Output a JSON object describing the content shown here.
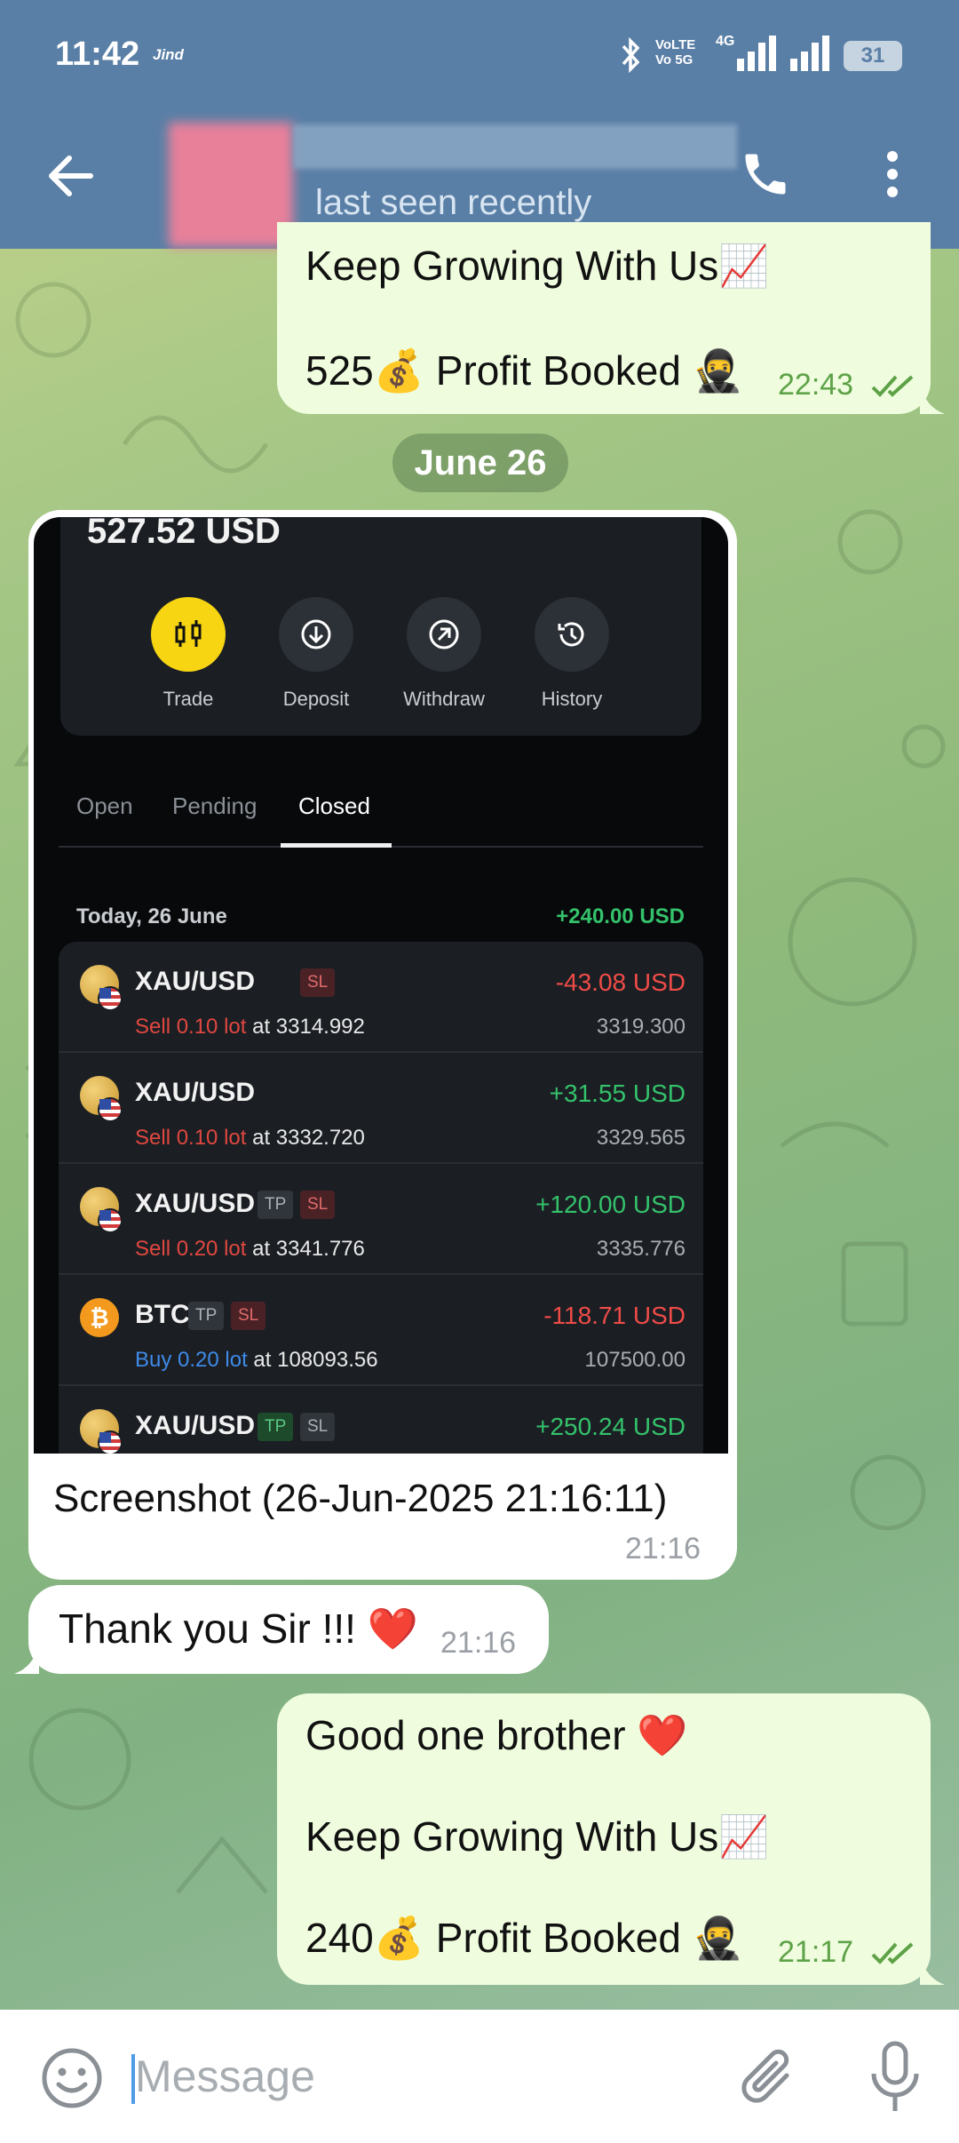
{
  "status_bar": {
    "time": "11:42",
    "carrier": "Jind",
    "volte_line1": "VoLTE",
    "volte_line2": "Vo 5G",
    "network": "4G",
    "battery": "31"
  },
  "header": {
    "subtitle": "last seen recently"
  },
  "messages": {
    "m1": {
      "line1": "Keep Growing With Us📈",
      "line2": "525💰 Profit Booked 🥷",
      "time": "22:43"
    },
    "date_divider": "June 26",
    "m2": {
      "caption": "Screenshot (26-Jun-2025 21:16:11)",
      "time": "21:16"
    },
    "m3": {
      "text": "Thank you Sir !!! ❤️",
      "time": "21:16"
    },
    "m4": {
      "line1": "Good one brother ❤️",
      "line2": "Keep Growing With Us📈",
      "line3": "240💰 Profit Booked 🥷",
      "time": "21:17"
    }
  },
  "screenshot": {
    "balance": "527.52 USD",
    "actions": [
      "Trade",
      "Deposit",
      "Withdraw",
      "History"
    ],
    "tabs": [
      "Open",
      "Pending",
      "Closed"
    ],
    "selected_tab": "Closed",
    "day_label": "Today, 26 June",
    "day_total": "+240.00 USD",
    "trades": [
      {
        "symbol": "XAU/USD",
        "tags": [
          "SL"
        ],
        "side": "Sell 0.10 lot",
        "entry": "at 3314.992",
        "pnl": "-43.08 USD",
        "close": "3319.300"
      },
      {
        "symbol": "XAU/USD",
        "tags": [],
        "side": "Sell 0.10 lot",
        "entry": "at 3332.720",
        "pnl": "+31.55 USD",
        "close": "3329.565"
      },
      {
        "symbol": "XAU/USD",
        "tags": [
          "TP",
          "SL"
        ],
        "side": "Sell 0.20 lot",
        "entry": "at 3341.776",
        "pnl": "+120.00 USD",
        "close": "3335.776"
      },
      {
        "symbol": "BTC",
        "tags": [
          "TP",
          "SL"
        ],
        "side": "Buy 0.20 lot",
        "entry": "at 108093.56",
        "pnl": "-118.71 USD",
        "close": "107500.00"
      },
      {
        "symbol": "XAU/USD",
        "tags": [
          "TP",
          "SL"
        ],
        "side": "",
        "entry": "",
        "pnl": "+250.24 USD",
        "close": ""
      }
    ]
  },
  "input": {
    "placeholder": "Message"
  },
  "colors": {
    "header": "#5a7fa6",
    "outgoing_bubble": "#effdde",
    "incoming_bubble": "#ffffff",
    "profit_green": "#34c26b",
    "loss_red": "#ef4b47",
    "trade_button_yellow": "#f7d513"
  }
}
